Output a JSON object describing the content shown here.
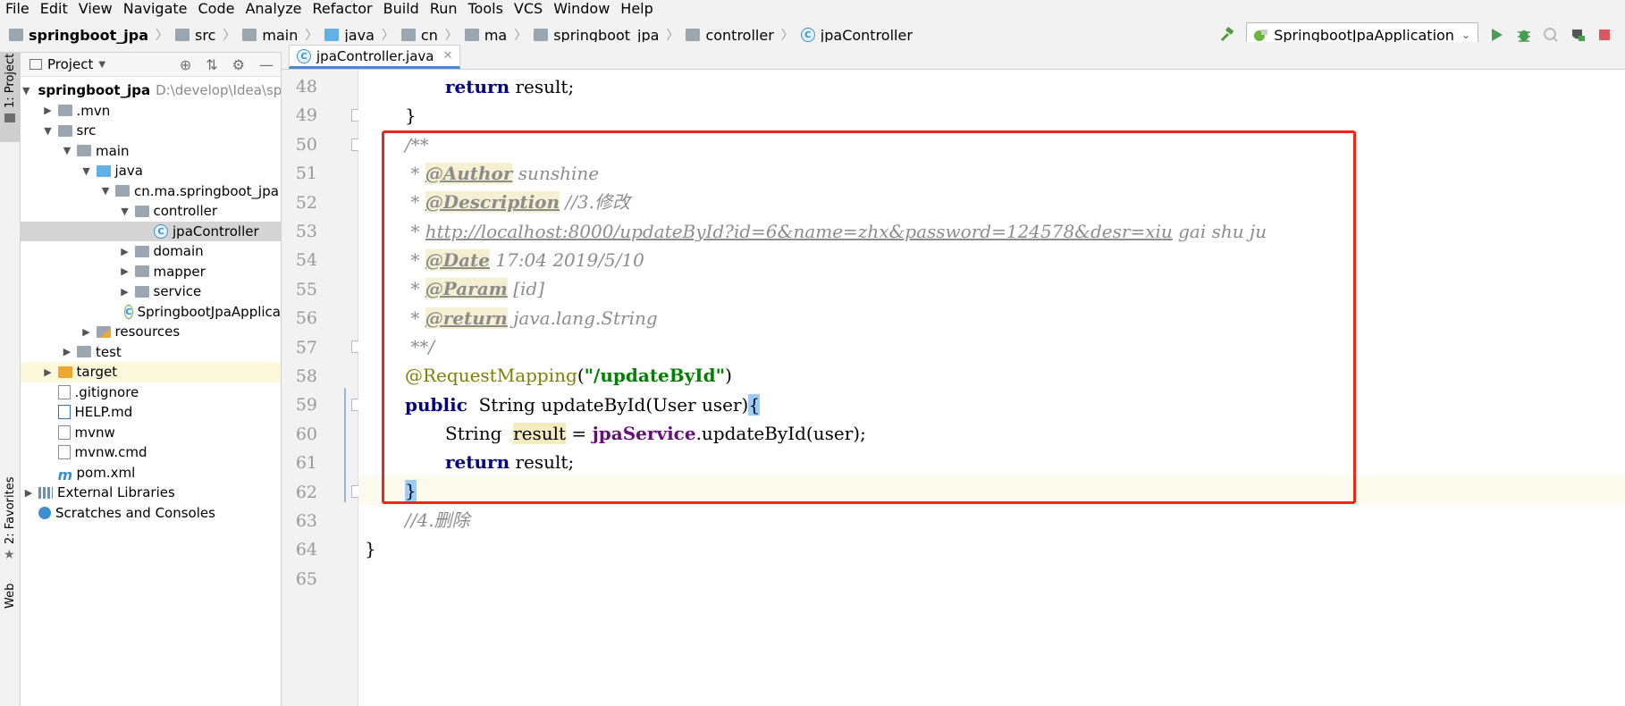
{
  "menu": [
    "File",
    "Edit",
    "View",
    "Navigate",
    "Code",
    "Analyze",
    "Refactor",
    "Build",
    "Run",
    "Tools",
    "VCS",
    "Window",
    "Help"
  ],
  "breadcrumb": [
    "springboot_jpa",
    "src",
    "main",
    "java",
    "cn",
    "ma",
    "springboot_jpa",
    "controller",
    "jpaController"
  ],
  "run_config": "SpringbootJpaApplication",
  "left_strip": {
    "project": "1: Project",
    "favorites": "2: Favorites",
    "web": "Web"
  },
  "project_panel": {
    "title": "Project",
    "root_name": "springboot_jpa",
    "root_path": "D:\\develop\\Idea\\spring",
    "items": [
      ".mvn",
      "src",
      "main",
      "java",
      "cn.ma.springboot_jpa",
      "controller",
      "jpaController",
      "domain",
      "mapper",
      "service",
      "SpringbootJpaApplica",
      "resources",
      "test",
      "target",
      ".gitignore",
      "HELP.md",
      "mvnw",
      "mvnw.cmd",
      "pom.xml",
      "External Libraries",
      "Scratches and Consoles"
    ]
  },
  "editor": {
    "tab": "jpaController.java",
    "line_numbers": [
      "48",
      "49",
      "50",
      "51",
      "52",
      "53",
      "54",
      "55",
      "56",
      "57",
      "58",
      "59",
      "60",
      "61",
      "62",
      "63",
      "64",
      "65"
    ],
    "code": {
      "l48_kw": "return",
      "l48_rest": " result;",
      "l49": "}",
      "l50": "/**",
      "l51_tag": "@Author",
      "l51_text": " sunshine",
      "l52_tag": "@Description",
      "l52_text": " //3.修改",
      "l53_url": "http://localhost:8000/updateById?id=6&name=zhx&password=124578&desr=xiu",
      "l53_text": " gai shu ju",
      "l54_tag": "@Date",
      "l54_text": " 17:04 2019/5/10",
      "l55_tag": "@Param",
      "l55_text": " [id]",
      "l56_tag": "@return",
      "l56_text": " java.lang.String",
      "l57": " **/",
      "l58_ann": "@RequestMapping",
      "l58_str": "\"/updateById\"",
      "l59_kw": "public",
      "l59_rest": "  String updateById(User user)",
      "l59_brace": "{",
      "l60_type": "String  ",
      "l60_var": "result",
      "l60_eq": " = ",
      "l60_fld": "jpaService",
      "l60_rest": ".updateById(user);",
      "l61_kw": "return",
      "l61_rest": " result;",
      "l62": "}",
      "l63": "//4.删除",
      "l64": "}"
    }
  }
}
